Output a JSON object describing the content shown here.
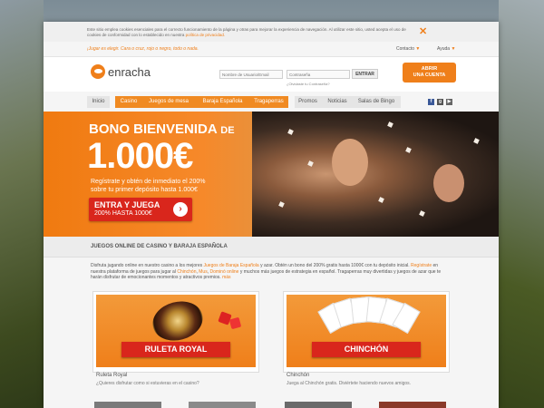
{
  "cookie": {
    "text": "Este sitio emplea cookies esenciales para el correcto funcionamiento de la página y otras para mejorar la experiencia de navegación. Al utilizar este sitio, usted acepta el uso de cookies de conformidad con lo establecido en nuestra",
    "policy_link": "política de privacidad."
  },
  "topbar": {
    "slogan": "¡Jugar es elegir. Cara o cruz, rojo o negro, todo o nada.",
    "contacto": "Contacto",
    "ayuda": "Ayuda"
  },
  "header": {
    "logo_text": "enracha",
    "user_placeholder": "Nombre de Usuario/Email",
    "pass_placeholder": "Contraseña",
    "forgot": "¿Olvidaste tu Contraseña?",
    "login_button": "ENTRAR",
    "open_account_line1": "ABRIR",
    "open_account_line2": "UNA CUENTA"
  },
  "nav": {
    "inicio": "Inicio",
    "casino": "Casino",
    "juegos_mesa": "Juegos de mesa",
    "baraja": "Baraja Española",
    "tragaperras": "Tragaperras",
    "promos": "Promos",
    "noticias": "Noticias",
    "bingo": "Salas de Bingo"
  },
  "banner": {
    "title": "BONO BIENVENIDA",
    "title_de": "DE",
    "amount": "1.000€",
    "desc_line1": "Regístrate y obtén de inmediato el 200%",
    "desc_line2": "sobre tu primer depósito hasta 1.000€",
    "cta_line1": "ENTRA Y JUEGA",
    "cta_line2": "200% HASTA 1000€"
  },
  "section": {
    "heading": "JUEGOS ONLINE DE CASINO Y BARAJA ESPAÑOLA",
    "p1a": "Disfruta jugando online en nuestro casino a los mejores ",
    "p1b": "Juegos de Baraja Española",
    "p1c": " y azar.  Obtén un bono del 200% gratis hasta 1000€ con tu depósito inicial. ",
    "p1d": "Regístrate",
    "p1e": " en nuestra plataforma de juegos para jugar al ",
    "p1f": "Chinchón",
    "p1g": ", ",
    "p1h": "Mus",
    "p1i": ", ",
    "p1j": "Dominó online",
    "p1k": " y muchos más juegos de estrategia en español. Tragaperras muy divertidas y juegos de azar que te harán disfrutar de emocionantes momentos y atractivos premios. ",
    "p1l": "más"
  },
  "cards": [
    {
      "banner": "RULETA ROYAL",
      "title": "Ruleta Royal",
      "subtitle": "¿Quieres disfrutar como si estuvieras en el casino?"
    },
    {
      "banner": "CHINCHÓN",
      "title": "Chinchón",
      "subtitle": "Juega al Chinchón gratis. Diviértete haciendo nuevos amigos."
    }
  ],
  "colors": {
    "accent": "#ef7f1a",
    "red": "#d9261c"
  }
}
